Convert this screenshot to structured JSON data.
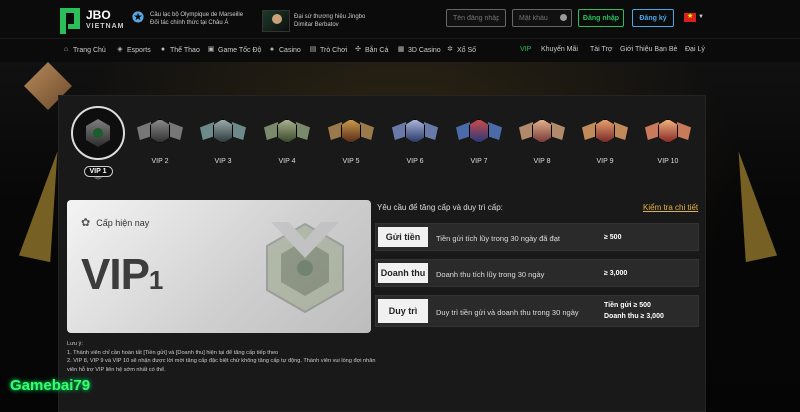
{
  "header": {
    "brand": "JBO",
    "brand_sub": "VIETNAM",
    "partner_line1": "Câu lạc bộ Olympique de Marseille",
    "partner_line2": "Đối tác chính thức tại Châu Á",
    "ambassador_line1": "Đại sứ thương hiệu Jingbo",
    "ambassador_line2": "Dimitar Berbatov",
    "username_placeholder": "Tên đăng nhập",
    "password_placeholder": "Mật khẩu",
    "login_label": "Đăng nhập",
    "register_label": "Đăng ký"
  },
  "nav": {
    "items": [
      {
        "label": "Trang Chủ",
        "icon": "home-icon"
      },
      {
        "label": "Esports",
        "icon": "gamepad-icon"
      },
      {
        "label": "Thể Thao",
        "icon": "ball-icon"
      },
      {
        "label": "Game Tốc Độ",
        "icon": "flash-icon"
      },
      {
        "label": "Casino",
        "icon": "cards-icon"
      },
      {
        "label": "Trò Chơi",
        "icon": "slot-icon"
      },
      {
        "label": "Bắn Cá",
        "icon": "fish-icon"
      },
      {
        "label": "3D Casino",
        "icon": "cube-icon"
      },
      {
        "label": "Xổ Số",
        "icon": "lottery-icon"
      },
      {
        "label": "VIP",
        "active": true
      },
      {
        "label": "Khuyến Mãi"
      },
      {
        "label": "Tài Trợ"
      },
      {
        "label": "Giới Thiệu Bạn Bè"
      },
      {
        "label": "Đại Lý"
      }
    ]
  },
  "tiers": {
    "current_label": "VIP 1",
    "others": [
      "VIP 2",
      "VIP 3",
      "VIP 4",
      "VIP 5",
      "VIP 6",
      "VIP 7",
      "VIP 8",
      "VIP 9",
      "VIP 10"
    ]
  },
  "current": {
    "heading": "Cấp hiện nay",
    "level_text": "VIP",
    "level_num": "1"
  },
  "requirements": {
    "title": "Yêu cầu để tăng cấp và duy trì cấp:",
    "link": "Kiểm tra chi tiết",
    "rows": [
      {
        "label": "Gửi tiền",
        "desc": "Tiền gửi tích lũy trong 30 ngày đã đạt",
        "value": "≥ 500"
      },
      {
        "label": "Doanh thu",
        "desc": "Doanh thu tích lũy trong 30 ngày",
        "value": "≥ 3,000"
      },
      {
        "label": "Duy trì",
        "desc": "Duy trì tiền gửi và doanh thu trong 30 ngày",
        "value1": "Tiền gửi ≥ 500",
        "value2": "Doanh thu ≥ 3,000"
      }
    ]
  },
  "notes": {
    "title": "Lưu ý:",
    "line1": "1. Thành viên chỉ cần hoàn tất [Tiền gửi] và [Doanh thu] hiện tại để tăng cấp tiếp theo",
    "line2": "2. VIP 8, VIP 9 và VIP 10 sẽ nhận được lời mời tăng cấp đặc biệt chứ không tăng cấp tự động. Thành viên vui lòng đợi nhân viên hỗ trợ VIP liên hệ sớm nhất có thể."
  },
  "watermark": "Gamebai79",
  "colors": {
    "accent": "#2bbf5b",
    "register": "#49a7e8",
    "link": "#e0b24a"
  }
}
